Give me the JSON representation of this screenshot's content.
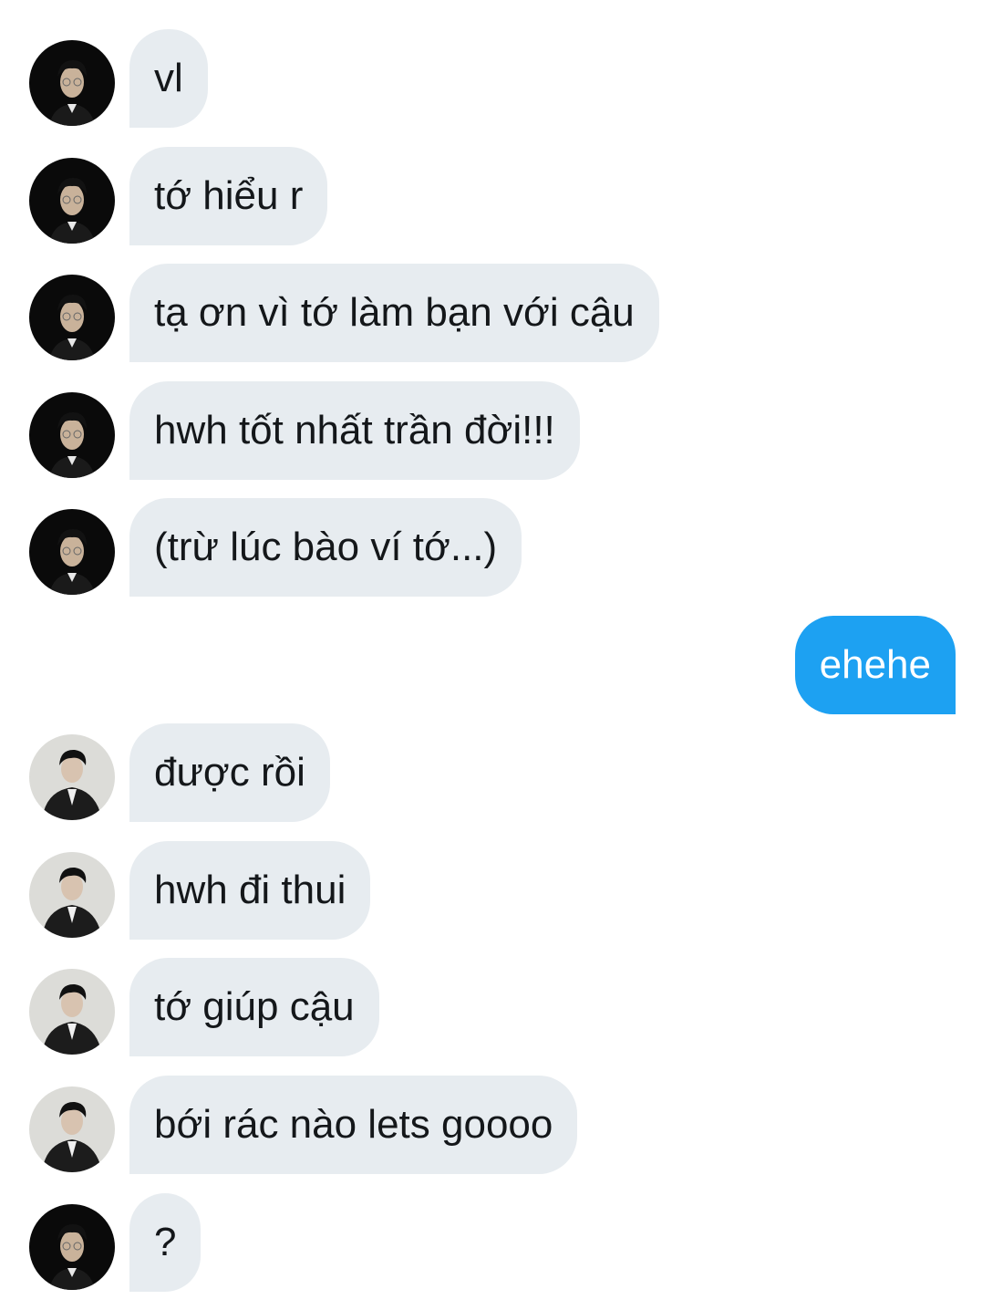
{
  "conversation": {
    "messages": [
      {
        "sender": "contact-a",
        "direction": "incoming",
        "text": "vl"
      },
      {
        "sender": "contact-a",
        "direction": "incoming",
        "text": "tớ hiểu r"
      },
      {
        "sender": "contact-a",
        "direction": "incoming",
        "text": "tạ ơn vì tớ làm bạn với cậu"
      },
      {
        "sender": "contact-a",
        "direction": "incoming",
        "text": "hwh tốt nhất trần đời!!!"
      },
      {
        "sender": "contact-a",
        "direction": "incoming",
        "text": "(trừ lúc bào ví tớ...)"
      },
      {
        "sender": "me",
        "direction": "outgoing",
        "text": "ehehe"
      },
      {
        "sender": "contact-b",
        "direction": "incoming",
        "text": "được rồi"
      },
      {
        "sender": "contact-b",
        "direction": "incoming",
        "text": "hwh đi thui"
      },
      {
        "sender": "contact-b",
        "direction": "incoming",
        "text": "tớ giúp cậu"
      },
      {
        "sender": "contact-b",
        "direction": "incoming",
        "text": "bới rác nào lets goooo"
      },
      {
        "sender": "contact-a",
        "direction": "incoming",
        "text": "?"
      }
    ]
  },
  "colors": {
    "incoming_bubble": "#e7ecf0",
    "incoming_text": "#14171a",
    "outgoing_bubble": "#1da1f2",
    "outgoing_text": "#ffffff",
    "background": "#ffffff"
  },
  "icons": {
    "avatar_contact_a": "avatar-icon",
    "avatar_contact_b": "avatar-icon"
  }
}
